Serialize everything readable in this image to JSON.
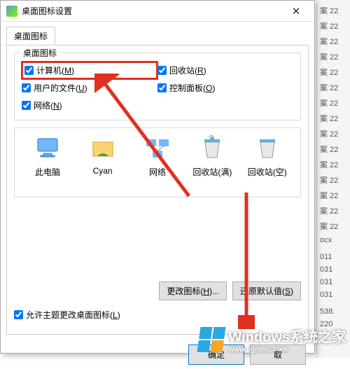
{
  "dialog": {
    "title": "桌面图标设置",
    "tab_label": "桌面图标",
    "group_title": "桌面图标",
    "checks": {
      "computer": "计算机(M)",
      "recycle": "回收站(R)",
      "userfiles": "用户的文件(U)",
      "controlpanel": "控制面板(O)",
      "network": "网络(N)"
    },
    "icons": [
      {
        "label": "此电脑"
      },
      {
        "label": "Cyan"
      },
      {
        "label": "网络"
      },
      {
        "label": "回收站(满)"
      },
      {
        "label": "回收站(空)"
      }
    ],
    "change_icon": "更改图标(H)...",
    "restore_default": "还原默认值(S)",
    "allow_theme": "允许主题更改桌面图标(L)",
    "ok": "确定",
    "cancel": "取"
  },
  "bg_items": [
    "案 22",
    "案 22",
    "案 22",
    "案 22",
    "案 22",
    "案 22",
    "案 22",
    "案 22",
    "案 22",
    "案 22",
    "案 22",
    "案 22",
    "案 22",
    "案 22",
    "案 22",
    "ocx",
    "",
    "011",
    "031",
    "031",
    "031",
    "",
    "538.",
    "220"
  ],
  "watermark": {
    "title": "Windows系统之家",
    "url": "www.bjjmmc.com"
  }
}
